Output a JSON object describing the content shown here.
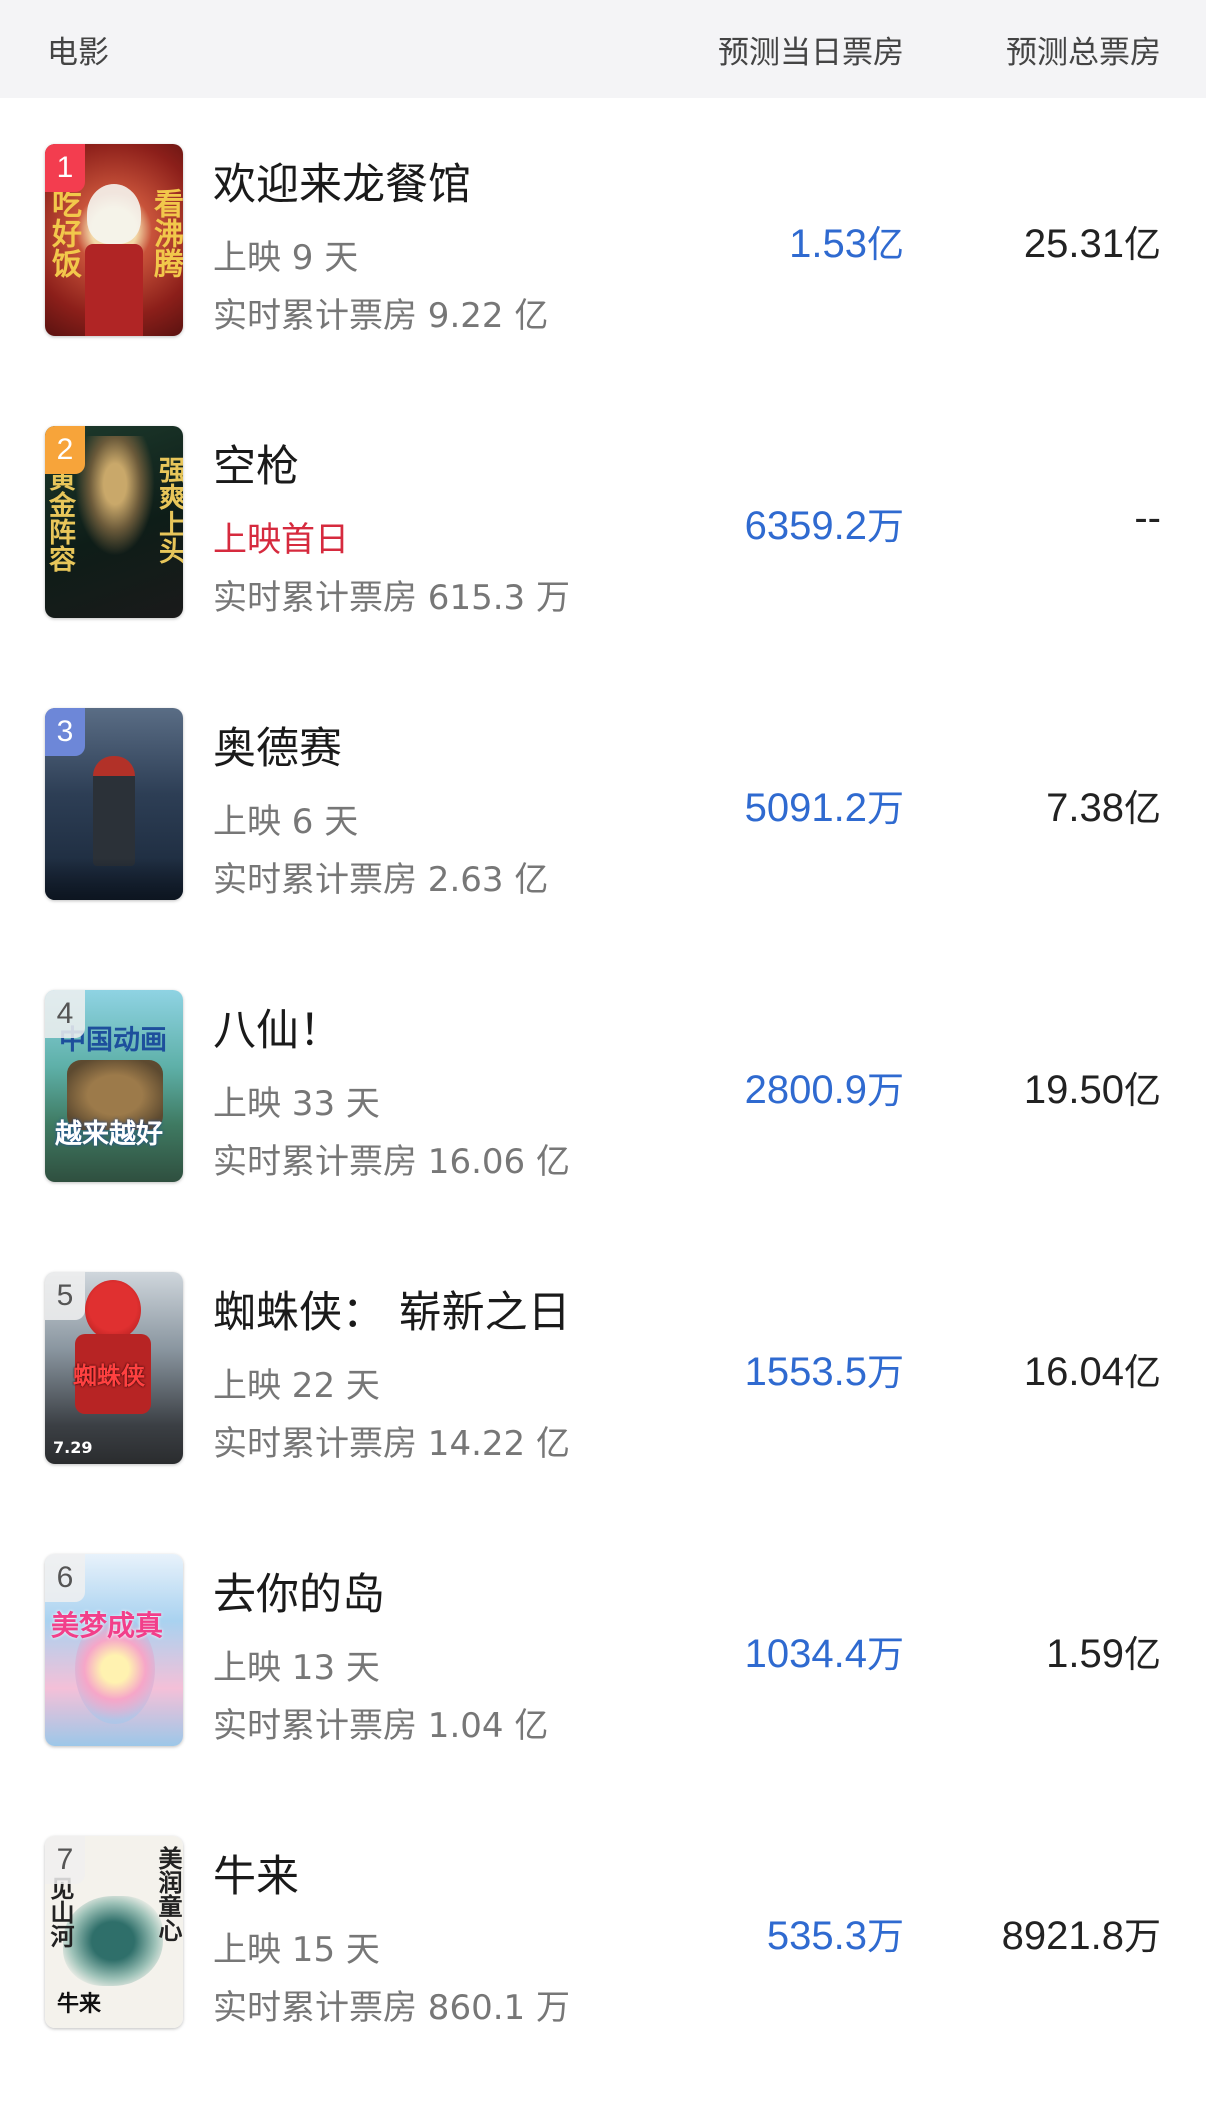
{
  "header": {
    "movie": "电影",
    "predicted_day": "预测当日票房",
    "predicted_total": "预测总票房"
  },
  "movies": [
    {
      "rank": "1",
      "title": "欢迎来龙餐馆",
      "status": "上映 9 天",
      "cumulative": "实时累计票房 9.22 亿",
      "day_value": "1.53",
      "day_unit": "亿",
      "total_value": "25.31",
      "total_unit": "亿",
      "poster_text_left": "吃好饭",
      "poster_text_right": "看沸腾"
    },
    {
      "rank": "2",
      "title": "空枪",
      "status": "上映首日",
      "cumulative": "实时累计票房 615.3 万",
      "day_value": "6359.2",
      "day_unit": "万",
      "total_value": "--",
      "total_unit": "",
      "poster_text_left": "黄金阵容",
      "poster_text_right": "强爽上头"
    },
    {
      "rank": "3",
      "title": "奥德赛",
      "status": "上映 6 天",
      "cumulative": "实时累计票房 2.63 亿",
      "day_value": "5091.2",
      "day_unit": "万",
      "total_value": "7.38",
      "total_unit": "亿"
    },
    {
      "rank": "4",
      "title": "八仙！",
      "status": "上映 33 天",
      "cumulative": "实时累计票房 16.06 亿",
      "day_value": "2800.9",
      "day_unit": "万",
      "total_value": "19.50",
      "total_unit": "亿",
      "poster_text_top": "中国动画",
      "poster_text_bottom": "越来越好"
    },
    {
      "rank": "5",
      "title": "蜘蛛侠： 崭新之日",
      "status": "上映 22 天",
      "cumulative": "实时累计票房 14.22 亿",
      "day_value": "1553.5",
      "day_unit": "万",
      "total_value": "16.04",
      "total_unit": "亿",
      "poster_text_mid": "蜘蛛侠",
      "poster_text_bottom": "7.29"
    },
    {
      "rank": "6",
      "title": "去你的岛",
      "status": "上映 13 天",
      "cumulative": "实时累计票房 1.04 亿",
      "day_value": "1034.4",
      "day_unit": "万",
      "total_value": "1.59",
      "total_unit": "亿",
      "poster_text_top": "美梦成真"
    },
    {
      "rank": "7",
      "title": "牛来",
      "status": "上映 15 天",
      "cumulative": "实时累计票房 860.1 万",
      "day_value": "535.3",
      "day_unit": "万",
      "total_value": "8921.8",
      "total_unit": "万",
      "poster_text_left": "见山河",
      "poster_text_right": "美润童心",
      "poster_text_bottom": "牛来"
    }
  ]
}
